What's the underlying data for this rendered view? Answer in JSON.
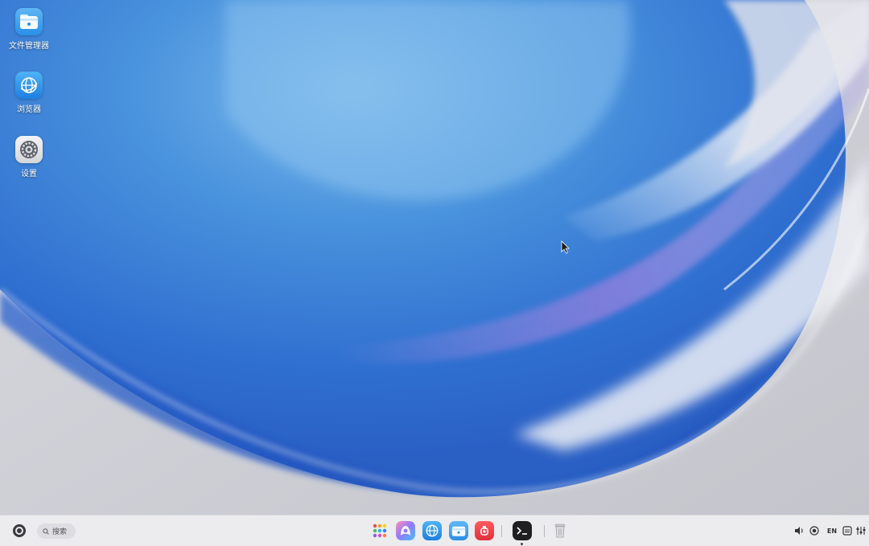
{
  "desktop": {
    "icons": [
      {
        "label": "文件管理器",
        "icon": "file-manager-icon"
      },
      {
        "label": "浏览器",
        "icon": "browser-icon"
      },
      {
        "label": "设置",
        "icon": "settings-icon"
      }
    ]
  },
  "taskbar": {
    "search": {
      "placeholder": "搜索"
    },
    "dock": [
      {
        "icon": "launcher-icon"
      },
      {
        "icon": "app-store-icon"
      },
      {
        "icon": "browser-icon"
      },
      {
        "icon": "file-manager-icon"
      },
      {
        "icon": "recorder-icon"
      },
      {
        "icon": "terminal-icon",
        "running": true
      },
      {
        "icon": "trash-icon"
      }
    ],
    "tray": {
      "volume_icon": "volume-icon",
      "record_icon": "record-icon",
      "language": "EN",
      "notification_icon": "notification-icon",
      "control_center_icon": "control-center-icon"
    }
  },
  "colors": {
    "taskbar_bg": "#ececee",
    "wallpaper_blue": "#3f86d8",
    "wallpaper_gray": "#cfd0d6"
  }
}
